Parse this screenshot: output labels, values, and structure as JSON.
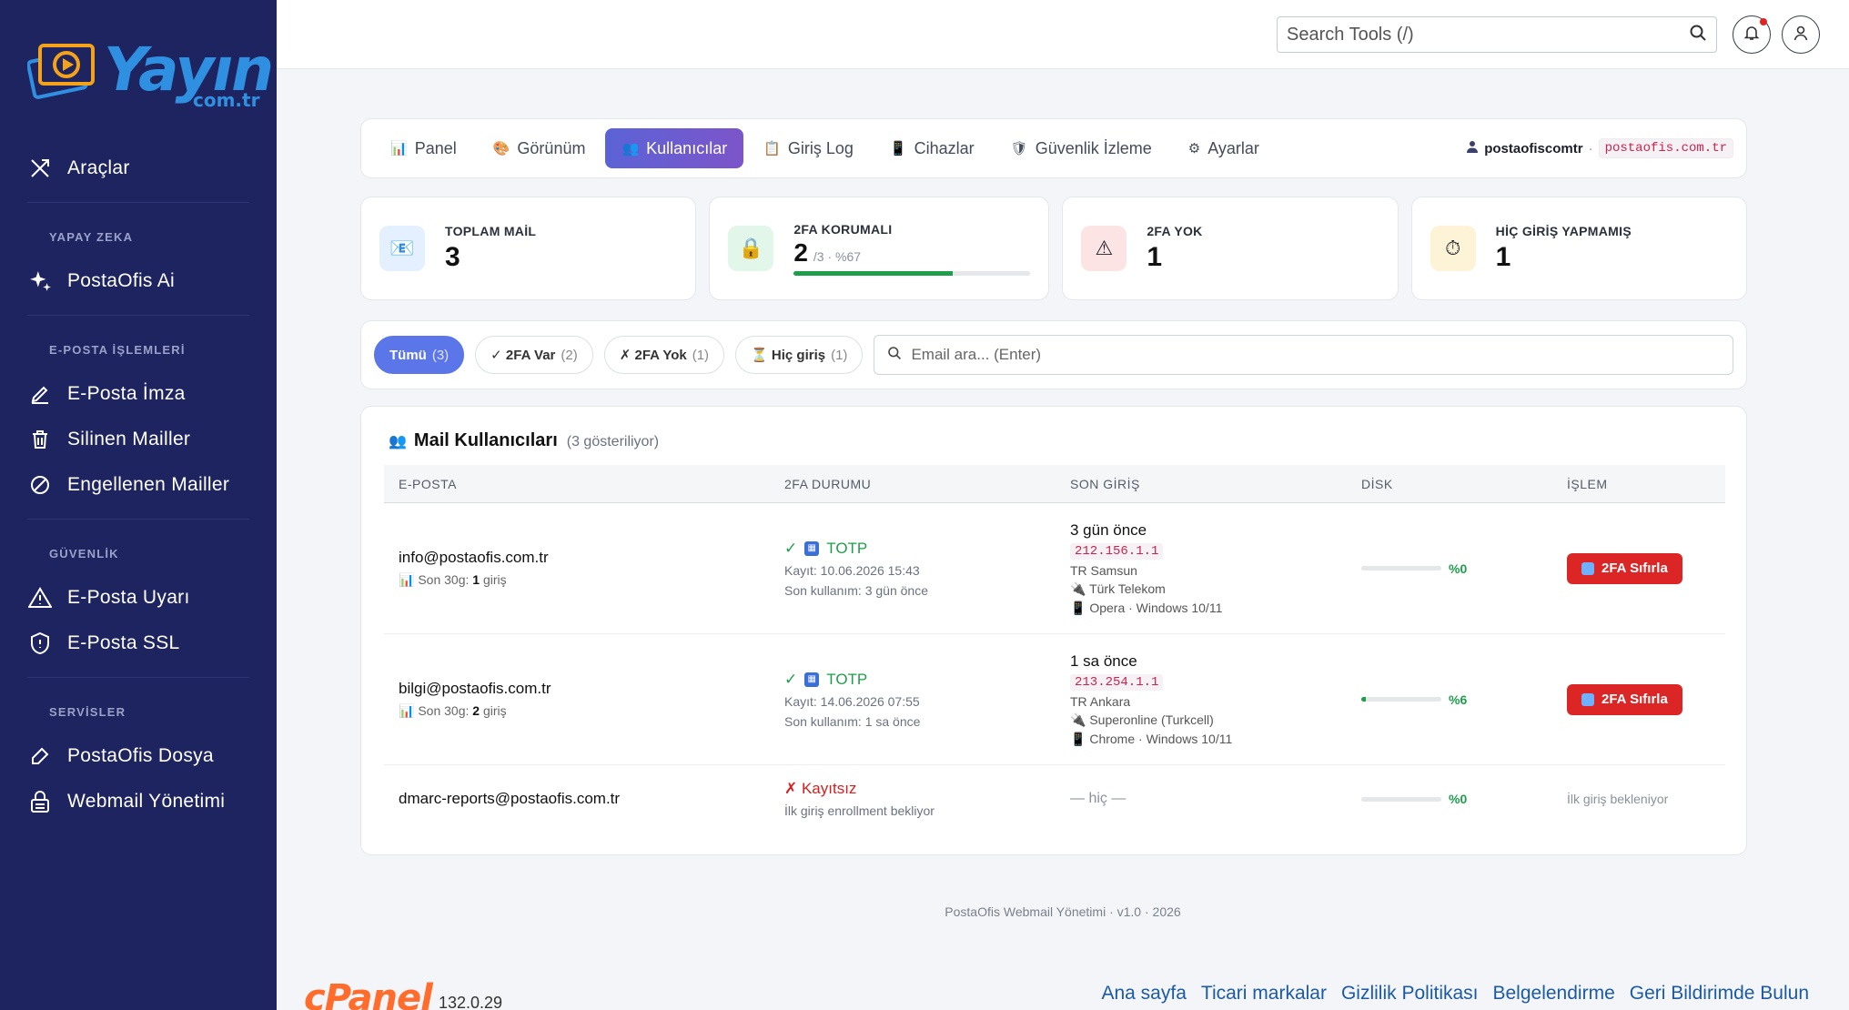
{
  "brand": {
    "logo_word": "Yayın",
    "logo_sub": "com.tr"
  },
  "sidebar": {
    "items": [
      {
        "label": "Araçlar",
        "icon": "tools-icon"
      },
      {
        "section": "YAPAY ZEKA"
      },
      {
        "label": "PostaOfis Ai",
        "icon": "sparkles-icon"
      },
      {
        "section": "E-POSTA İŞLEMLERİ"
      },
      {
        "label": "E-Posta İmza",
        "icon": "pen-icon"
      },
      {
        "label": "Silinen Mailler",
        "icon": "trash-icon"
      },
      {
        "label": "Engellenen Mailler",
        "icon": "block-icon"
      },
      {
        "section": "GÜVENLİK"
      },
      {
        "label": "E-Posta Uyarı",
        "icon": "warning-icon"
      },
      {
        "label": "E-Posta SSL",
        "icon": "shield-icon"
      },
      {
        "section": "SERVİSLER"
      },
      {
        "label": "PostaOfis Dosya",
        "icon": "file-icon"
      },
      {
        "label": "Webmail Yönetimi",
        "icon": "lock-icon"
      }
    ]
  },
  "topbar": {
    "search_placeholder": "Search Tools (/)"
  },
  "tabs": [
    {
      "label": "Panel",
      "icon": "📊"
    },
    {
      "label": "Görünüm",
      "icon": "🎨"
    },
    {
      "label": "Kullanıcılar",
      "icon": "👥",
      "active": true
    },
    {
      "label": "Giriş Log",
      "icon": "📋"
    },
    {
      "label": "Cihazlar",
      "icon": "📱"
    },
    {
      "label": "Güvenlik İzleme",
      "icon": "🛡"
    },
    {
      "label": "Ayarlar",
      "icon": "⚙"
    }
  ],
  "account": {
    "user": "postaofiscomtr",
    "sep": "·",
    "domain": "postaofis.com.tr"
  },
  "stats": [
    {
      "label": "TOPLAM MAİL",
      "value": "3",
      "icon": "📧",
      "bg": "#e4efff"
    },
    {
      "label": "2FA KORUMALI",
      "value": "2",
      "sub": "/3 · %67",
      "icon": "🔒",
      "bg": "#e2f6e9",
      "progress": 0.67
    },
    {
      "label": "2FA YOK",
      "value": "1",
      "icon": "⚠",
      "bg": "#fde4e4"
    },
    {
      "label": "HİÇ GİRİŞ YAPMAMIŞ",
      "value": "1",
      "icon": "⏱",
      "bg": "#fdf3d6"
    }
  ],
  "filters": {
    "chips": [
      {
        "label": "Tümü",
        "count": "(3)",
        "active": true
      },
      {
        "label": "✓ 2FA Var",
        "count": "(2)"
      },
      {
        "label": "✗ 2FA Yok",
        "count": "(1)"
      },
      {
        "label": "⏳ Hiç giriş",
        "count": "(1)"
      }
    ],
    "search_placeholder": "Email ara... (Enter)"
  },
  "table": {
    "title": "Mail Kullanıcıları",
    "count": "(3 gösteriliyor)",
    "headers": [
      "E-POSTA",
      "2FA DURUMU",
      "SON GİRİŞ",
      "DİSK",
      "İŞLEM"
    ],
    "rows": [
      {
        "email": "info@postaofis.com.tr",
        "sub_prefix": "Son 30g:",
        "sub_count": "1",
        "sub_suffix": "giriş",
        "twofa": "TOTP",
        "registered": "Kayıt: 10.06.2026 15:43",
        "used": "Son kullanım: 3 gün önce",
        "last": "3 gün önce",
        "ip": "212.156.1.1",
        "city": "TR Samsun",
        "isp": "Türk Telekom",
        "device": "Opera · Windows 10/11",
        "disk": 0,
        "disk_label": "%0",
        "action": "2FA Sıfırla"
      },
      {
        "email": "bilgi@postaofis.com.tr",
        "sub_prefix": "Son 30g:",
        "sub_count": "2",
        "sub_suffix": "giriş",
        "twofa": "TOTP",
        "registered": "Kayıt: 14.06.2026 07:55",
        "used": "Son kullanım: 1 sa önce",
        "last": "1 sa önce",
        "ip": "213.254.1.1",
        "city": "TR Ankara",
        "isp": "Superonline (Turkcell)",
        "device": "Chrome · Windows 10/11",
        "disk": 0.06,
        "disk_label": "%6",
        "action": "2FA Sıfırla"
      },
      {
        "email": "dmarc-reports@postaofis.com.tr",
        "unreg": "✗ Kayıtsız",
        "unreg_sub": "İlk giriş enrollment bekliyor",
        "last_none": "— hiç —",
        "disk": 0,
        "disk_label": "%0",
        "action_wait": "İlk giriş bekleniyor"
      }
    ]
  },
  "footer": {
    "version_text": "PostaOfis Webmail Yönetimi · v1.0 · 2026"
  },
  "cpanel": {
    "logo": "cPanel",
    "version": "132.0.29",
    "links": [
      "Ana sayfa",
      "Ticari markalar",
      "Gizlilik Politikası",
      "Belgelendirme",
      "Geri Bildirimde Bulun"
    ]
  },
  "colors": {
    "sidebar": "#1e2460",
    "accent": "#5b63d6",
    "success": "#1e9e4a",
    "danger": "#dc2626"
  }
}
